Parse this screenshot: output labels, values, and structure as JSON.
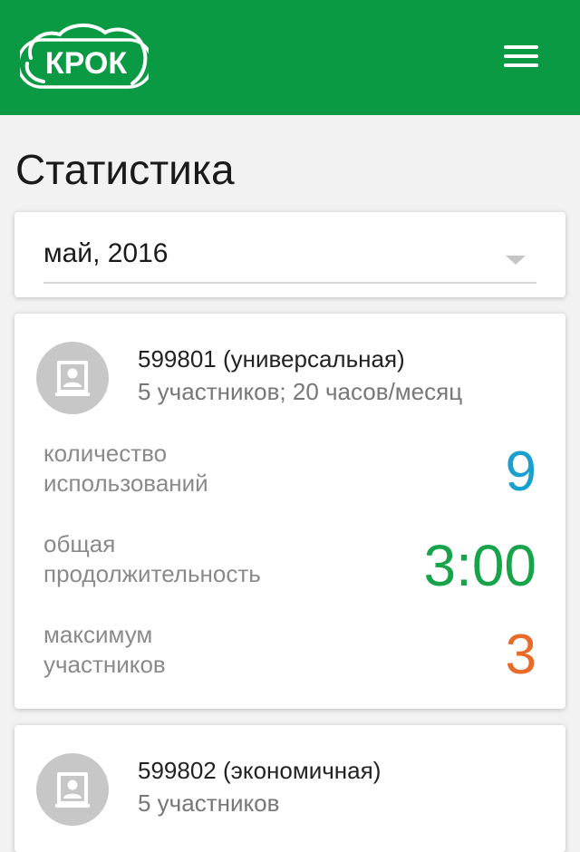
{
  "header": {
    "logo_text": "КРОК",
    "menu_icon": "hamburger-menu-icon",
    "background": "#099a43"
  },
  "page": {
    "title": "Статистика"
  },
  "period_select": {
    "value": "май, 2016"
  },
  "accounts": [
    {
      "name": "599801 (универсальная)",
      "details": "5 участников; 20 часов/месяц",
      "stats": [
        {
          "label_line1": "количество",
          "label_line2": "использований",
          "value": "9",
          "color": "#1aa0cf"
        },
        {
          "label_line1": "общая",
          "label_line2": "продолжительность",
          "value": "3:00",
          "color": "#16a34a"
        },
        {
          "label_line1": "максимум",
          "label_line2": "участников",
          "value": "3",
          "color": "#ea6a2a"
        }
      ]
    },
    {
      "name": "599802 (экономичная)",
      "details": "5 участников"
    }
  ]
}
